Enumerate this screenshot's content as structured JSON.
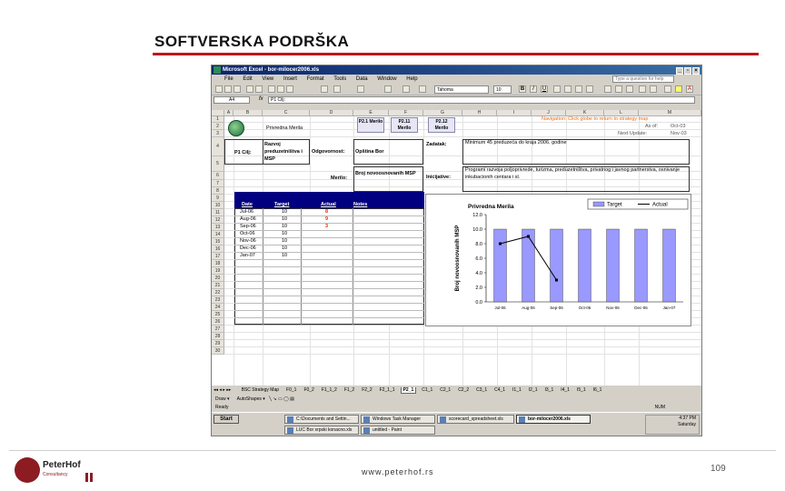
{
  "slide": {
    "title": "SOFTVERSKA PODRŠKA",
    "footer_url": "www.peterhof.rs",
    "page_number": "109",
    "logo_text": "PeterHof",
    "logo_sub": "Consultancy",
    "accent_color": "#c0141c"
  },
  "excel": {
    "window_title": "Microsoft Excel - bor-milocer2006.xls",
    "menu": [
      "File",
      "Edit",
      "View",
      "Insert",
      "Format",
      "Tools",
      "Data",
      "Window",
      "Help"
    ],
    "help_placeholder": "Type a question for help",
    "font_name": "Tahoma",
    "font_size": "10",
    "name_box": "A4",
    "formula": "P1 Cilj:",
    "columns": [
      "A",
      "B",
      "C",
      "D",
      "E",
      "F",
      "G",
      "H",
      "I",
      "J",
      "K",
      "L",
      "M"
    ],
    "rows": [
      "1",
      "2",
      "3",
      "4",
      "5",
      "6",
      "7",
      "8",
      "9",
      "10",
      "11",
      "12",
      "13",
      "14",
      "15",
      "16",
      "17",
      "18",
      "19",
      "20",
      "21",
      "22",
      "23",
      "24",
      "25",
      "26",
      "27",
      "28",
      "29",
      "30"
    ],
    "sheet": {
      "measure_name": "Privredna Merila",
      "nav_buttons": [
        "P2.1 Merilo",
        "P2.11 Merilo",
        "P2.12 Merilo"
      ],
      "navigation_text": "Navigation:  Click globe to return to strategy map",
      "as_of_label": "As of:",
      "as_of_value": "Oct-03",
      "next_update_label": "Next Update:",
      "next_update_value": "Nov-03",
      "goal_label": "P1 Cilj:",
      "goal_text": "Razvoj preduzetništva i MSP",
      "responsibility_label": "Odgovornost:",
      "responsibility_value": "Opština Bor",
      "task_label": "Zadatak:",
      "task_value": "Minimum 45 preduzeća do kraja 2006. godine",
      "measure_label": "Merilo:",
      "measure_value": "Broj novoosnovanih MSP",
      "initiative_label": "Inicijative:",
      "initiative_value": "Programi razvoja poljoprivrede, turizma, preduzetništva, privatnog i javnog partnerstva, osnivanje inkubacionih centara i sl.",
      "table_headers": [
        "Date",
        "Target",
        "Actual",
        "Notes"
      ],
      "table_rows": [
        {
          "date": "Jul-06",
          "target": "10",
          "actual": "8"
        },
        {
          "date": "Aug-06",
          "target": "10",
          "actual": "9"
        },
        {
          "date": "Sep-06",
          "target": "10",
          "actual": "3"
        },
        {
          "date": "Oct-06",
          "target": "10",
          "actual": ""
        },
        {
          "date": "Nov-06",
          "target": "10",
          "actual": ""
        },
        {
          "date": "Dec-06",
          "target": "10",
          "actual": ""
        },
        {
          "date": "Jan-07",
          "target": "10",
          "actual": ""
        }
      ]
    },
    "sheet_tabs": [
      "BSC Strategy Map",
      "F0_1",
      "F0_2",
      "F1_1_2",
      "F1_2",
      "F2_2",
      "F2_1_1",
      "P2_1",
      "C1_1",
      "C2_1",
      "C2_2",
      "C3_1",
      "C4_1",
      "I1_1",
      "I2_1",
      "I3_1",
      "I4_1",
      "I5_1",
      "I6_1"
    ],
    "active_tab": "P2_1",
    "draw_label": "Draw",
    "autoshapes_label": "AutoShapes",
    "status_ready": "Ready",
    "status_num": "NUM"
  },
  "taskbar": {
    "start_label": "Start",
    "items": [
      "C:\\Documents and Settin...",
      "Windows Task Manager",
      "scorecard_spreadsheet.xls",
      "bor-milocer2006.xls",
      "LUC Bor srpski konacno.xls",
      "untitled - Paint"
    ],
    "clock_time": "4:37 PM",
    "clock_day": "Saturday"
  },
  "chart_data": {
    "type": "bar",
    "title": "Privredna Merila",
    "ylabel": "Broj novoosnovanih MSP",
    "xlabel": "",
    "categories": [
      "Jul-06",
      "Aug-06",
      "Sep-06",
      "Oct-06",
      "Nov-06",
      "Dec-06",
      "Jan-07"
    ],
    "series": [
      {
        "name": "Target",
        "type": "bar",
        "values": [
          10,
          10,
          10,
          10,
          10,
          10,
          10
        ],
        "color": "#9999ff"
      },
      {
        "name": "Actual",
        "type": "line",
        "values": [
          8,
          9,
          3,
          null,
          null,
          null,
          null
        ],
        "color": "#000000"
      }
    ],
    "ylim": [
      0,
      12
    ],
    "yticks": [
      "0.0",
      "2.0",
      "4.0",
      "6.0",
      "8.0",
      "10.0",
      "12.0"
    ],
    "grid": false,
    "legend": "top-right"
  }
}
